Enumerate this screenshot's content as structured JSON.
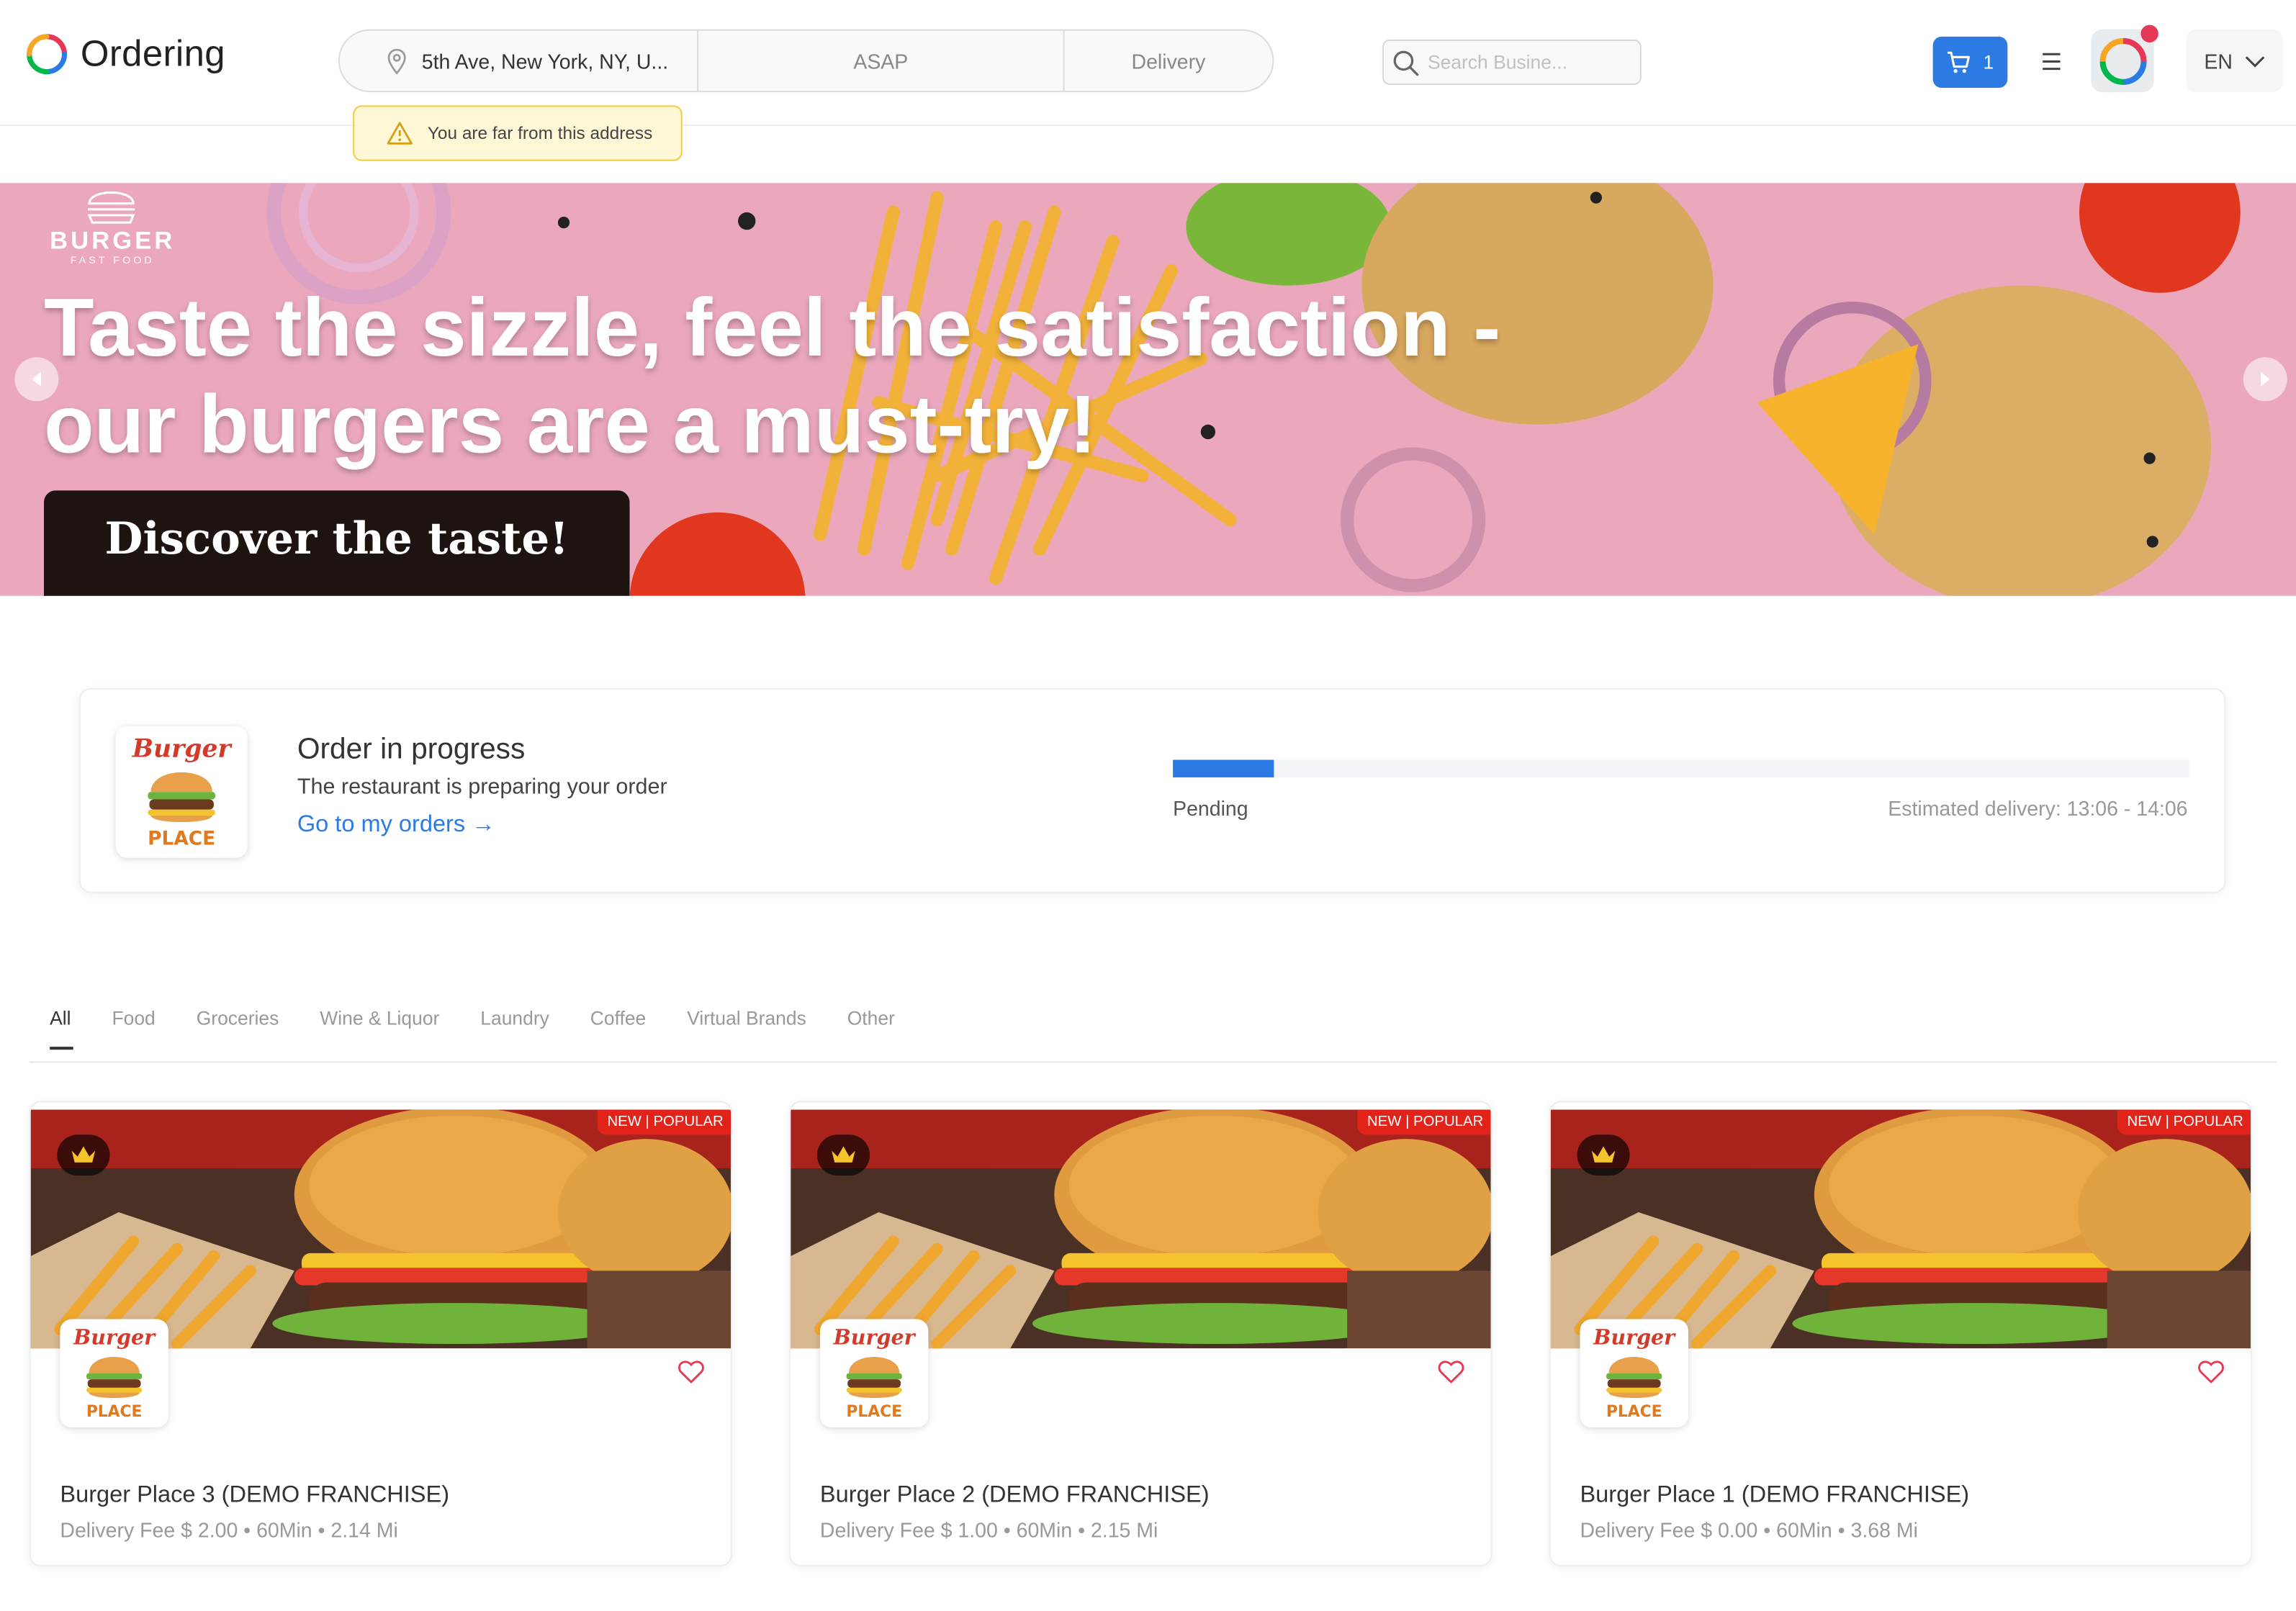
{
  "header": {
    "brand": "Ordering",
    "address": "5th Ave, New York, NY, U...",
    "time": "ASAP",
    "mode": "Delivery",
    "warning": "You are far from this address",
    "search_placeholder": "Search Busine...",
    "cart_count": "1",
    "language": "EN"
  },
  "banner": {
    "brand_title": "BURGER",
    "brand_subtitle": "FAST FOOD",
    "headline_line1": "Taste the sizzle, feel the satisfaction -",
    "headline_line2": "our burgers are a must-try!",
    "cta": "Discover the taste!"
  },
  "order": {
    "title": "Order in progress",
    "subtitle": "The restaurant is preparing your order",
    "link": "Go to my orders →",
    "status": "Pending",
    "eta": "Estimated delivery: 13:06 - 14:06",
    "progress": 0.1
  },
  "tabs": [
    "All",
    "Food",
    "Groceries",
    "Wine & Liquor",
    "Laundry",
    "Coffee",
    "Virtual Brands",
    "Other"
  ],
  "businesses": [
    {
      "badge": "NEW | POPULAR",
      "name": "Burger Place 3 (DEMO FRANCHISE)",
      "meta": "Delivery Fee   $ 2.00 • 60Min • 2.14 Mi"
    },
    {
      "badge": "NEW | POPULAR",
      "name": "Burger Place 2 (DEMO FRANCHISE)",
      "meta": "Delivery Fee   $ 1.00 • 60Min • 2.15 Mi"
    },
    {
      "badge": "NEW | POPULAR",
      "name": "Burger Place 1 (DEMO FRANCHISE)",
      "meta": "Delivery Fee   $ 0.00 • 60Min • 3.68 Mi"
    }
  ],
  "logo_text": {
    "top": "Burger",
    "bottom": "PLACE"
  },
  "colors": {
    "accent": "#2c7be5",
    "badge": "#e2231a",
    "warning_bg": "#fff8d6",
    "banner_bg": "#eba8bd"
  }
}
